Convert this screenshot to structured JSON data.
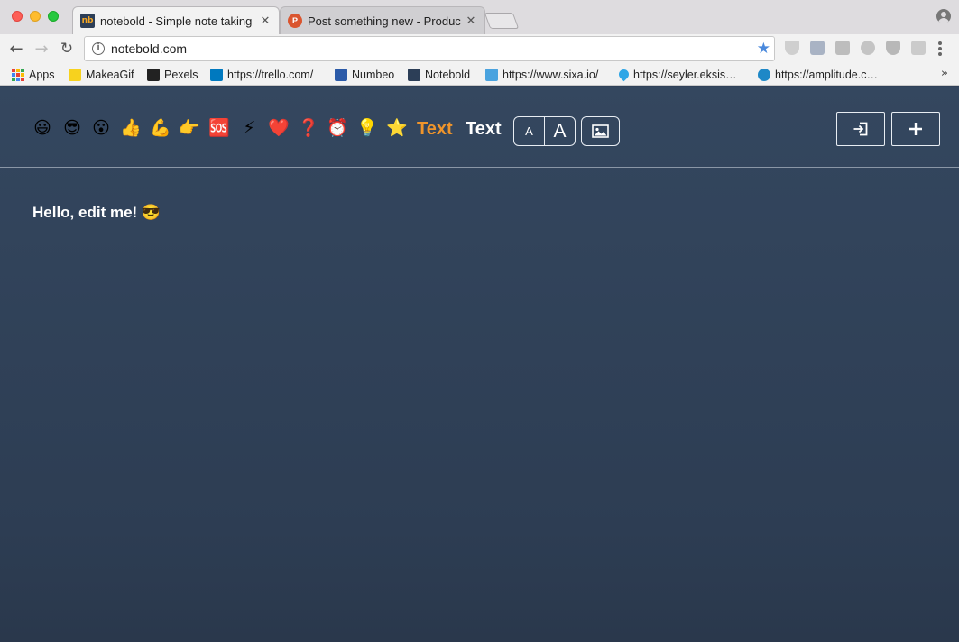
{
  "browser": {
    "tabs": [
      {
        "title": "notebold - Simple note taking",
        "favicon": "notebold-logo",
        "favicon_text": "nb",
        "active": true
      },
      {
        "title": "Post something new - Product",
        "favicon": "producthunt-logo",
        "favicon_text": "P",
        "active": false
      }
    ],
    "tab_close_glyph": "✕",
    "url": "notebold.com",
    "bookmarks": [
      {
        "label": "Apps",
        "icon": "apps-grid-icon"
      },
      {
        "label": "MakeaGif",
        "icon": "makeagif-icon"
      },
      {
        "label": "Pexels",
        "icon": "pexels-icon"
      },
      {
        "label": "https://trello.com/",
        "icon": "trello-icon"
      },
      {
        "label": "Numbeo",
        "icon": "numbeo-icon"
      },
      {
        "label": "Notebold",
        "icon": "notebold-icon"
      },
      {
        "label": "https://www.sixa.io/",
        "icon": "sixa-icon"
      },
      {
        "label": "https://seyler.eksis…",
        "icon": "droplet-icon"
      },
      {
        "label": "https://amplitude.c…",
        "icon": "amplitude-icon"
      }
    ],
    "bookmarks_overflow": "»"
  },
  "app": {
    "emojis": [
      {
        "name": "grinning-face",
        "char": "😃"
      },
      {
        "name": "sunglasses-face",
        "char": "😎"
      },
      {
        "name": "surprised-face",
        "char": "😮"
      },
      {
        "name": "thumbs-up",
        "char": "👍"
      },
      {
        "name": "flexed-biceps",
        "char": "💪"
      },
      {
        "name": "pointing-right",
        "char": "👉"
      },
      {
        "name": "sos",
        "char": "🆘"
      },
      {
        "name": "lightning",
        "char": "⚡"
      },
      {
        "name": "red-heart",
        "char": "❤️"
      },
      {
        "name": "question-mark",
        "char": "❓"
      },
      {
        "name": "alarm-clock",
        "char": "⏰"
      },
      {
        "name": "light-bulb",
        "char": "💡"
      },
      {
        "name": "star",
        "char": "⭐"
      }
    ],
    "text_orange": "Text",
    "text_white": "Text",
    "size_small": "A",
    "size_large": "A",
    "note_text": "Hello, edit me! 😎",
    "colors": {
      "background": "#2f4058",
      "accent_orange": "#f0952b",
      "text_white": "#ffffff",
      "divider": "#8a96a6"
    }
  }
}
